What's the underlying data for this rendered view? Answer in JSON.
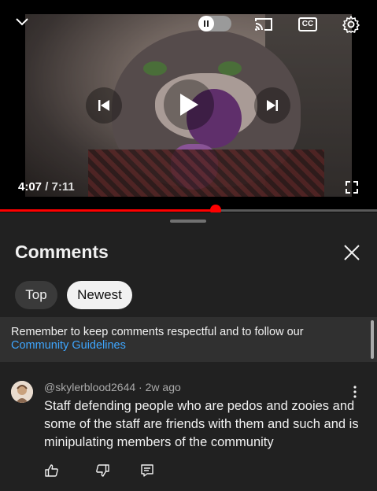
{
  "player": {
    "current_time": "4:07",
    "separator": " / ",
    "duration": "7:11",
    "progress_fraction": 0.573,
    "autoplay_enabled": false,
    "icons": [
      "collapse-chevron-icon",
      "autoplay-pause-icon",
      "cast-icon",
      "captions-icon",
      "settings-gear-icon",
      "previous-icon",
      "play-icon",
      "next-icon",
      "fullscreen-icon"
    ],
    "captions_label": "CC"
  },
  "comments": {
    "title": "Comments",
    "sort_tabs": [
      {
        "label": "Top",
        "selected": false
      },
      {
        "label": "Newest",
        "selected": true
      }
    ],
    "notice": {
      "text": "Remember to keep comments respectful and to follow our",
      "link": "Community Guidelines"
    },
    "items": [
      {
        "author": "@skylerblood2644",
        "dot": " · ",
        "age": "2w ago",
        "text": "Staff defending people who are pedos and zooies and some of the staff are friends with them and such and is minipulating members of the community"
      }
    ]
  },
  "colors": {
    "background": "#0f0f0f",
    "sheet": "#212121",
    "accent_red": "#ff0000",
    "link_blue": "#3ea6ff"
  }
}
